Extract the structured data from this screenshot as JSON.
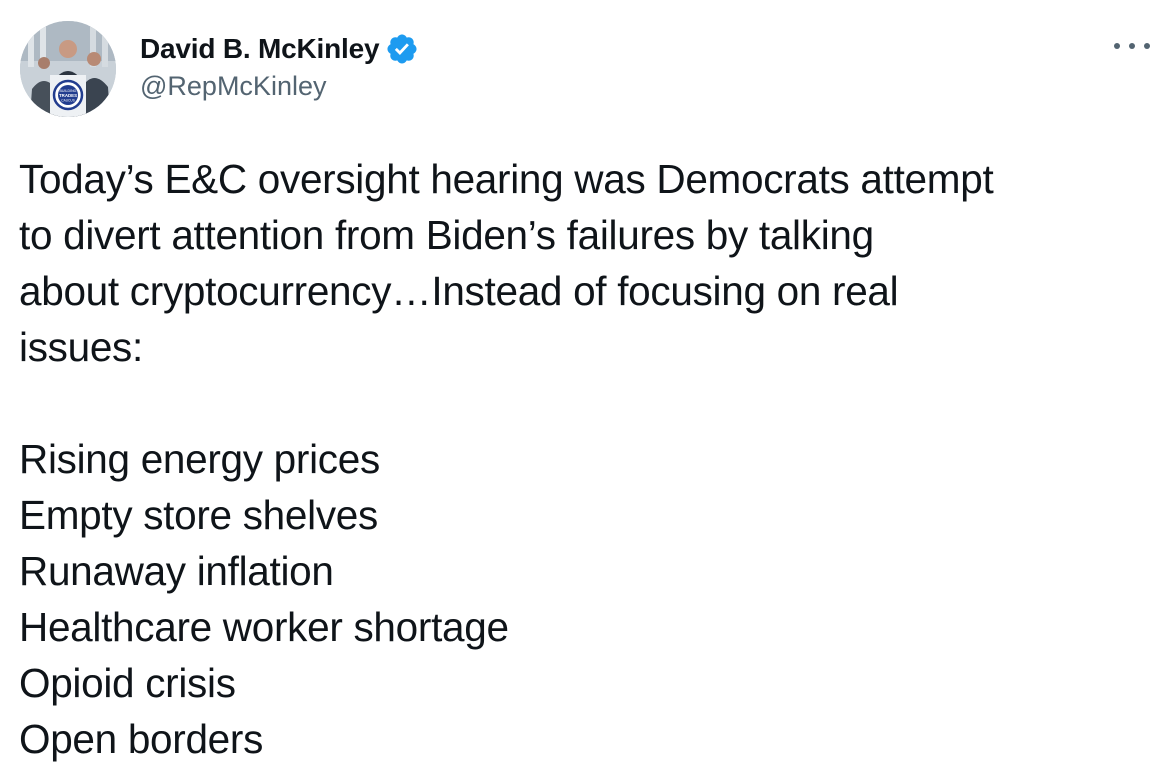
{
  "author": {
    "display_name": "David B. McKinley",
    "handle": "@RepMcKinley",
    "verified_icon": "verified-badge-icon",
    "avatar_logo_text": [
      "BUILDING",
      "TRADES",
      "CAUCUS"
    ]
  },
  "menu": {
    "icon": "more-options-icon"
  },
  "tweet": {
    "paragraph_lines": [
      "Today’s E&C oversight hearing was Democrats attempt",
      "to divert attention from Biden’s failures by talking",
      "about cryptocurrency…Instead of focusing on real",
      "issues:"
    ],
    "list_items": [
      "Rising energy prices",
      "Empty store shelves",
      "Runaway inflation",
      "Healthcare worker shortage",
      "Opioid crisis",
      "Open borders"
    ]
  },
  "colors": {
    "text_primary": "#0f1419",
    "text_secondary": "#536471",
    "verified_blue": "#1d9bf0",
    "background": "#ffffff"
  }
}
